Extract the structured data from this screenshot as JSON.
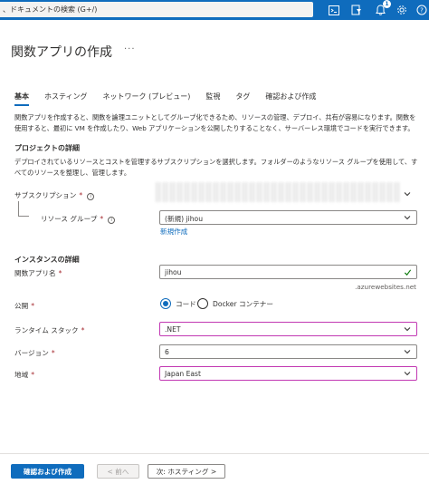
{
  "topbar": {
    "search_placeholder": "、ドキュメントの検索 (G+/)",
    "notification_count": "1",
    "icons": [
      "cloud-shell-icon",
      "directory-filter-icon",
      "notifications-icon",
      "settings-icon",
      "help-icon"
    ]
  },
  "page": {
    "title": "関数アプリの作成",
    "more": "···"
  },
  "tabs": [
    {
      "label": "基本",
      "active": true
    },
    {
      "label": "ホスティング"
    },
    {
      "label": "ネットワーク (プレビュー)"
    },
    {
      "label": "監視"
    },
    {
      "label": "タグ"
    },
    {
      "label": "確認および作成"
    }
  ],
  "intro": "関数アプリを作成すると、関数を論理ユニットとしてグループ化できるため、リソースの管理、デプロイ、共有が容易になります。関数を使用すると、最初に VM を作成したり、Web アプリケーションを公開したりすることなく、サーバーレス環境でコードを実行できます。",
  "project": {
    "heading": "プロジェクトの詳細",
    "description": "デプロイされているリソースとコストを管理するサブスクリプションを選択します。フォルダーのようなリソース グループを使用して、すべてのリソースを整理し、管理します。",
    "subscription_label": "サブスクリプション",
    "resource_group_label": "リソース グループ",
    "resource_group_value": "(新規) jihou",
    "create_new_link": "新規作成"
  },
  "instance": {
    "heading": "インスタンスの詳細",
    "app_name_label": "関数アプリ名",
    "app_name_value": "jihou",
    "domain_suffix": ".azurewebsites.net",
    "publish_label": "公開",
    "publish_options": [
      {
        "label": "コード",
        "selected": true
      },
      {
        "label": "Docker コンテナー",
        "selected": false
      }
    ],
    "runtime_label": "ランタイム スタック",
    "runtime_value": ".NET",
    "version_label": "バージョン",
    "version_value": "6",
    "region_label": "地域",
    "region_value": "Japan East"
  },
  "footer": {
    "review_create": "確認および作成",
    "previous": "< 前へ",
    "next": "次: ホスティング >"
  },
  "colors": {
    "accent": "#0f6cbd",
    "required": "#a4262c",
    "highlight_border": "#c239b3"
  }
}
